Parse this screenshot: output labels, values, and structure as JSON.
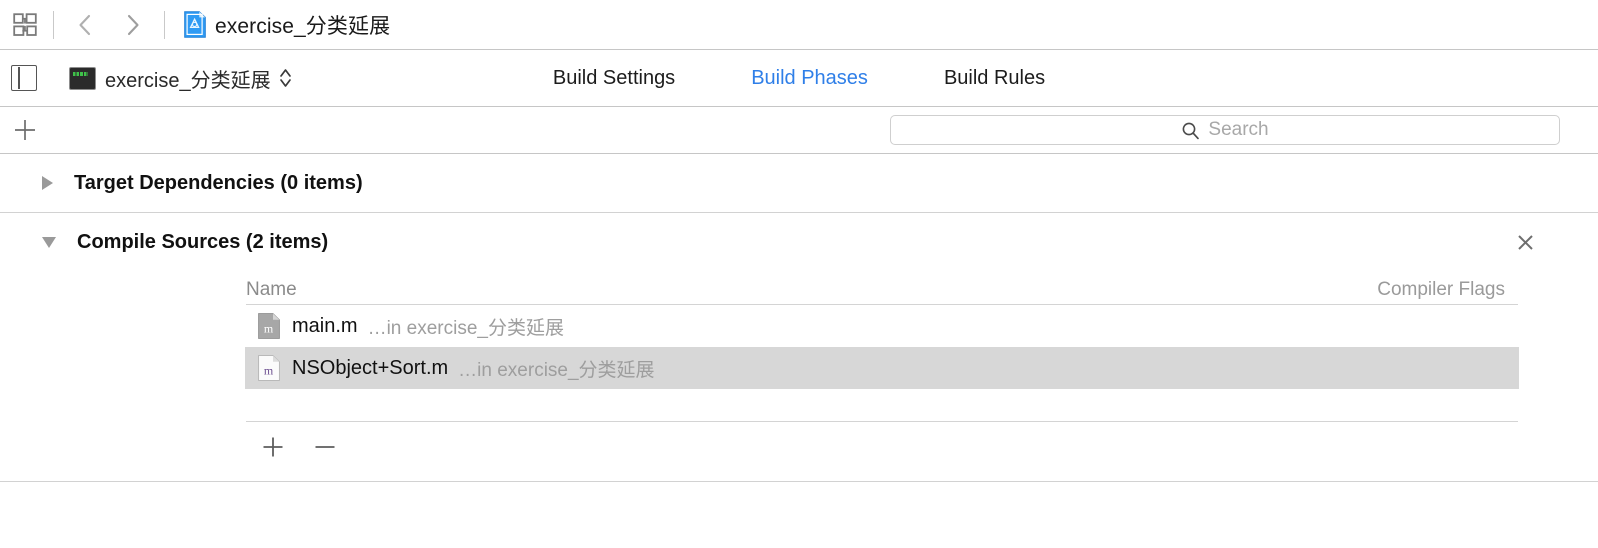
{
  "toolbar": {
    "grid_icon": "navigator-grid-icon",
    "back_icon": "chevron-left-icon",
    "forward_icon": "chevron-right-icon",
    "doc_icon": "xcode-project-icon",
    "title": "exercise_分类延展"
  },
  "tabbar": {
    "pane_toggle_icon": "left-pane-toggle-icon",
    "target_icon": "command-line-tool-target-icon",
    "target_name": "exercise_分类延展",
    "stepper_icon": "up-down-chevrons-icon",
    "tabs": [
      {
        "label": "Build Settings",
        "selected": false
      },
      {
        "label": "Build Phases",
        "selected": true
      },
      {
        "label": "Build Rules",
        "selected": false
      }
    ],
    "selected_color": "#2f7fe8"
  },
  "searchrow": {
    "add_icon": "plus-icon",
    "search_icon": "search-icon",
    "search_placeholder": "Search",
    "search_value": ""
  },
  "phases": [
    {
      "title": "Target Dependencies (0 items)",
      "expanded": false,
      "disclosure_icon": "disclosure-triangle-right-icon"
    },
    {
      "title": "Compile Sources (2 items)",
      "expanded": true,
      "disclosure_icon": "disclosure-triangle-down-icon",
      "close_icon": "close-icon",
      "columns": [
        "Name",
        "Compiler Flags"
      ],
      "rows": [
        {
          "icon": "objective-c-file-icon",
          "name": "main.m",
          "location": "…in exercise_分类延展",
          "flags": "",
          "selected": false
        },
        {
          "icon": "objective-c-file-icon",
          "name": "NSObject+Sort.m",
          "location": "…in exercise_分类延展",
          "flags": "",
          "selected": true
        }
      ],
      "footer": {
        "add_icon": "plus-icon",
        "remove_icon": "minus-icon"
      }
    }
  ]
}
